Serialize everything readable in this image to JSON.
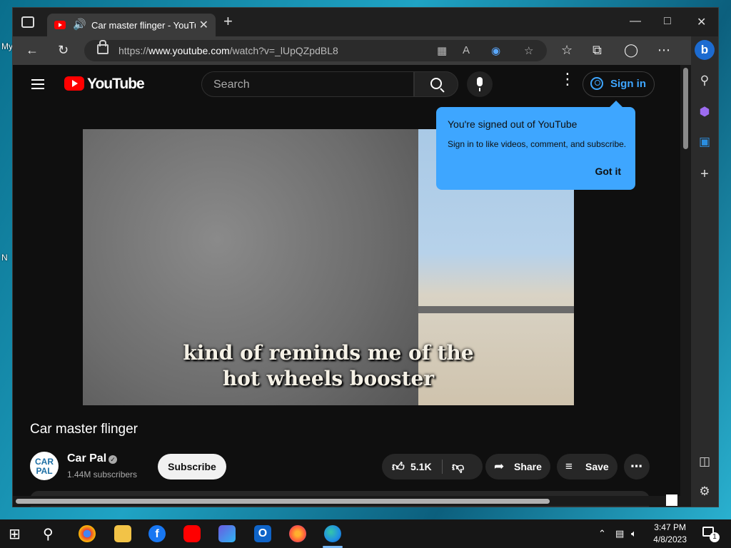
{
  "desktop": {
    "labels": [
      "My",
      "N"
    ]
  },
  "browser": {
    "tab": {
      "title": "Car master flinger - YouTube"
    },
    "address": {
      "scheme": "https://",
      "host": "www.youtube.com",
      "path": "/watch?v=_lUpQZpdBL8"
    },
    "window_controls": [
      "minimize",
      "maximize",
      "close"
    ],
    "toolbar_icons": [
      "back-icon",
      "refresh-icon",
      "apps-icon",
      "read-aloud-icon",
      "extension-icon",
      "add-favorite-icon",
      "favorites-icon",
      "collections-icon",
      "profile-icon",
      "more-icon"
    ],
    "sidebar_icons": [
      "bing-icon",
      "search-icon",
      "games-icon",
      "outlook-icon",
      "add-icon",
      "split-screen-icon",
      "settings-icon"
    ]
  },
  "youtube": {
    "logo_text": "YouTube",
    "search": {
      "placeholder": "Search"
    },
    "signin_label": "Sign in",
    "tooltip": {
      "title": "You're signed out of YouTube",
      "body": "Sign in to like videos, comment, and subscribe.",
      "action": "Got it"
    },
    "video": {
      "caption_line1": "kind of reminds me of the",
      "caption_line2": "hot wheels booster",
      "title": "Car master flinger"
    },
    "channel": {
      "avatar_text_top": "CAR",
      "avatar_text_bottom": "PAL",
      "name": "Car Pal",
      "subscribers": "1.44M subscribers",
      "subscribe_label": "Subscribe"
    },
    "actions": {
      "likes": "5.1K",
      "share_label": "Share",
      "save_label": "Save"
    }
  },
  "taskbar": {
    "apps": [
      "start",
      "search",
      "chrome",
      "file-explorer",
      "facebook",
      "youtube",
      "app",
      "outlook",
      "firefox",
      "edge"
    ],
    "time": "3:47 PM",
    "date": "4/8/2023",
    "notification_count": "1"
  }
}
